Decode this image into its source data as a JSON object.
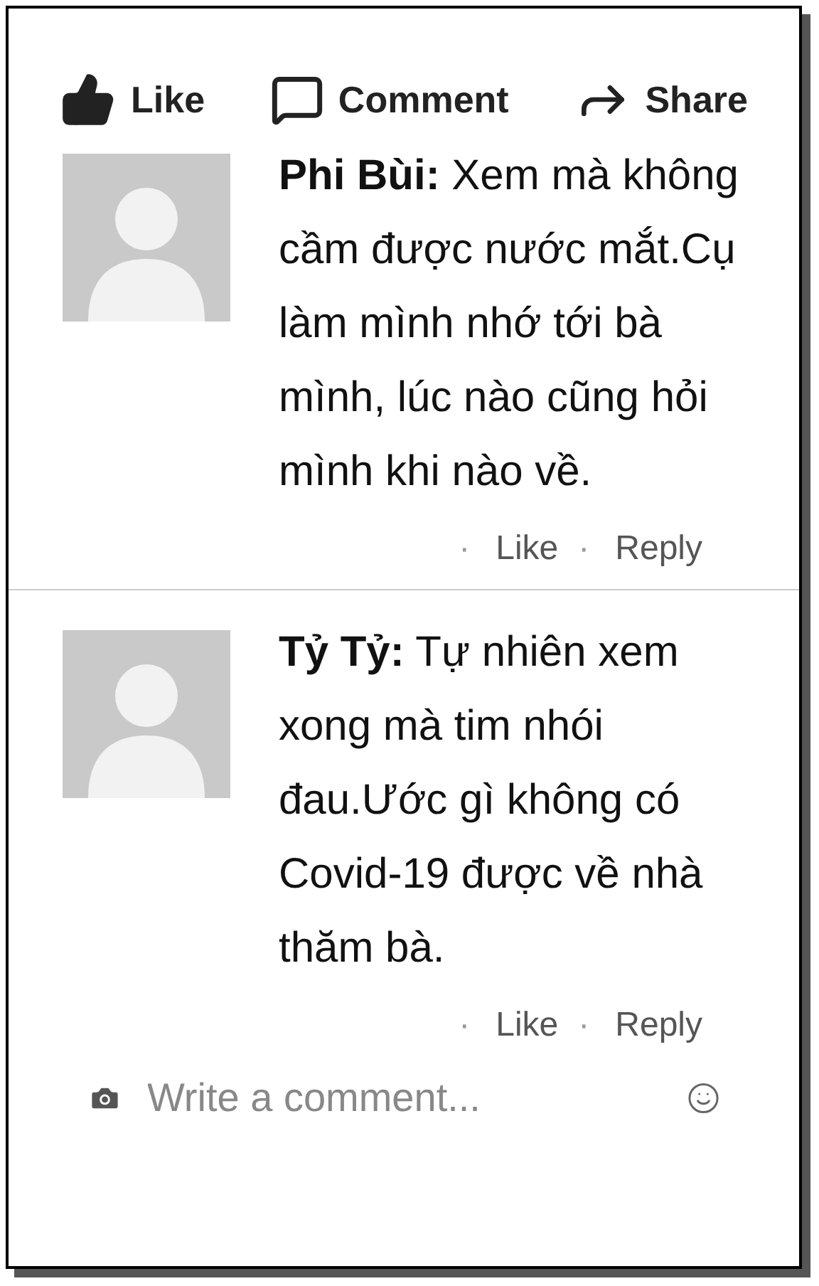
{
  "actions": [
    {
      "kind": "like",
      "label": "Like"
    },
    {
      "kind": "comment",
      "label": "Comment"
    },
    {
      "kind": "share",
      "label": "Share"
    }
  ],
  "comments": [
    {
      "author": "Phi Bùi:",
      "text": "Xem mà không cầm được nước mắt.Cụ làm mình nhớ tới bà mình, lúc nào cũng hỏi mình khi nào về.",
      "links": [
        {
          "dot": "·",
          "label": "Like"
        },
        {
          "dot": "·",
          "label": "Reply"
        }
      ]
    },
    {
      "author": "Tỷ Tỷ:",
      "text": "Tự nhiên xem xong mà tim nhói đau.Ước gì không có Covid-19 được về nhà thăm bà.",
      "links": [
        {
          "dot": "·",
          "label": "Like"
        },
        {
          "dot": "·",
          "label": "Reply"
        }
      ]
    }
  ],
  "composer": {
    "placeholder": "Write a comment..."
  }
}
